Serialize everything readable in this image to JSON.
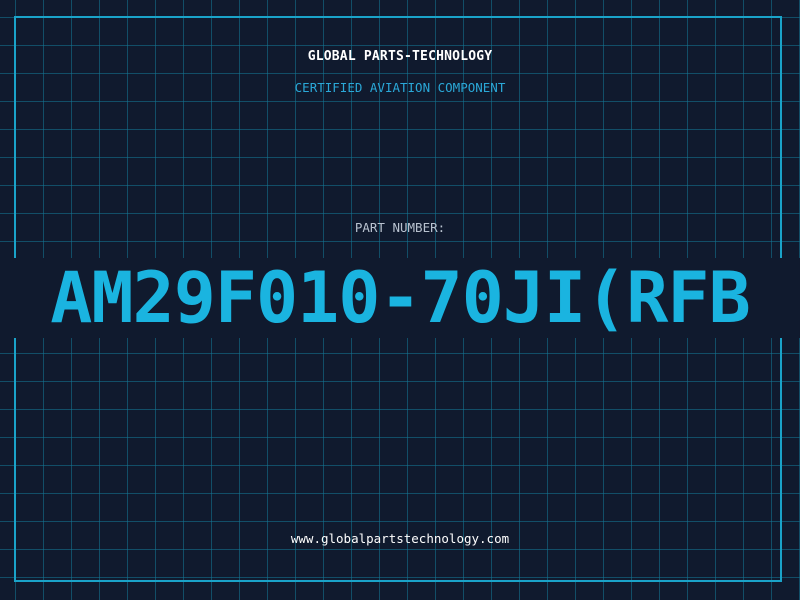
{
  "header": {
    "company": "GLOBAL PARTS-TECHNOLOGY",
    "subtitle": "CERTIFIED AVIATION COMPONENT"
  },
  "part": {
    "label": "PART NUMBER:",
    "number": "AM29F010-70JI(RFB"
  },
  "footer": {
    "website": "www.globalpartstechnology.com"
  },
  "colors": {
    "background": "#101a2e",
    "grid": "#14789b",
    "accent": "#1ab4e0",
    "frame": "#1aa3c9"
  }
}
